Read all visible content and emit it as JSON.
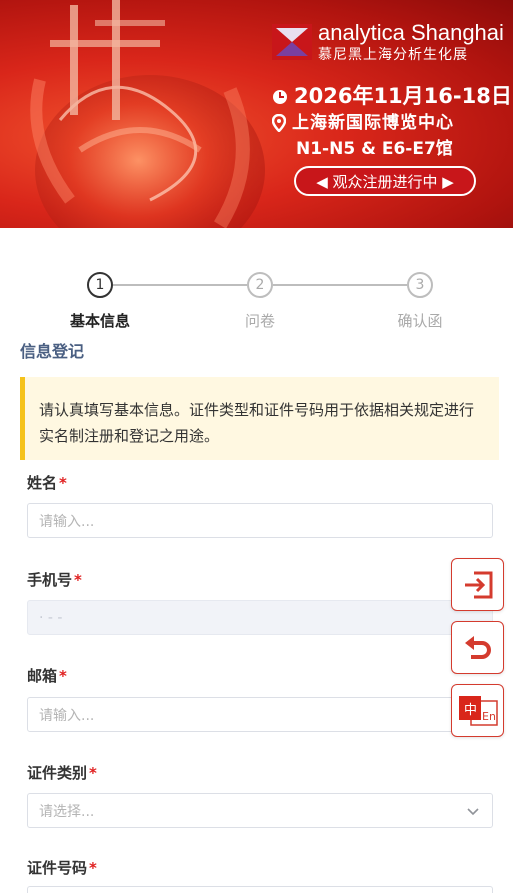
{
  "banner": {
    "brand_en": "analytica Shanghai",
    "brand_cn": "慕尼黑上海分析生化展",
    "date": "2026年11月16-18日",
    "venue": "上海新国际博览中心",
    "halls": "N1-N5 & E6-E7馆",
    "register_button": "◀ 观众注册进行中 ▶"
  },
  "steps": [
    {
      "number": "1",
      "label": "基本信息",
      "state": "active"
    },
    {
      "number": "2",
      "label": "问卷",
      "state": "inactive"
    },
    {
      "number": "3",
      "label": "确认函",
      "state": "inactive"
    }
  ],
  "section_title": "信息登记",
  "notice": "请认真填写基本信息。证件类型和证件号码用于依据相关规定进行实名制注册和登记之用途。",
  "form": {
    "name": {
      "label": "姓名",
      "required_mark": "*",
      "placeholder": "请输入..."
    },
    "phone": {
      "label": "手机号",
      "required_mark": "*",
      "value": "· - -"
    },
    "email": {
      "label": "邮箱",
      "required_mark": "*",
      "placeholder": "请输入..."
    },
    "id_type": {
      "label": "证件类别",
      "required_mark": "*",
      "placeholder": "请选择..."
    },
    "id_number": {
      "label": "证件号码",
      "required_mark": "*"
    }
  },
  "floating": {
    "lang_cn": "中",
    "lang_en": "En"
  },
  "colors": {
    "banner_red": "#d9261a",
    "accent_red": "#d43b2e",
    "title_blue": "#4a5f82",
    "notice_bg": "#fff8e1",
    "notice_border": "#f5c21b",
    "required": "#e02020"
  },
  "icons": [
    "clock-icon",
    "location-icon",
    "exit-icon",
    "undo-icon",
    "language-switch-icon",
    "chevron-down-icon"
  ]
}
